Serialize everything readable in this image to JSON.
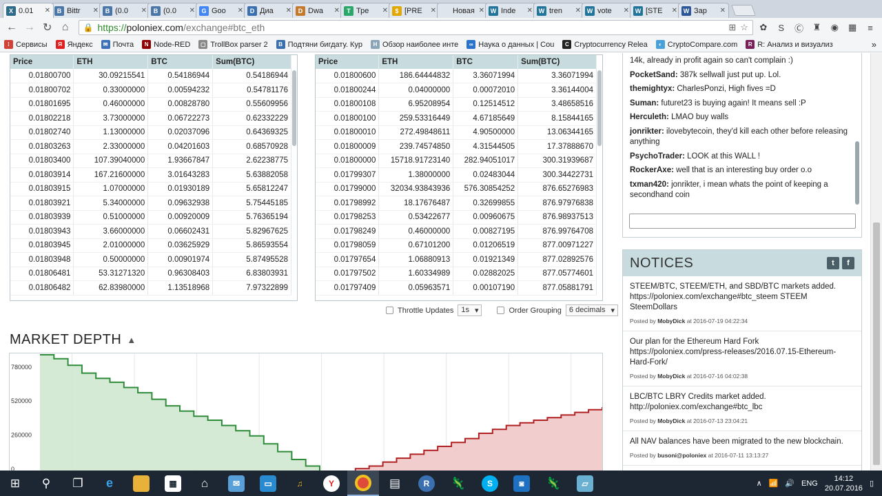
{
  "browser": {
    "tabs": [
      {
        "label": "0.01",
        "icon": "poloniex-favicon",
        "color": "#2e6b8a",
        "glyph": "X",
        "active": true
      },
      {
        "label": "Bittr",
        "icon": "vk-favicon",
        "color": "#4a76a8",
        "glyph": "B"
      },
      {
        "label": "(0.0",
        "icon": "vk-favicon",
        "color": "#4a76a8",
        "glyph": "B"
      },
      {
        "label": "(0.0",
        "icon": "vk-favicon",
        "color": "#4a76a8",
        "glyph": "B"
      },
      {
        "label": "Goo",
        "icon": "google-favicon",
        "color": "#4285f4",
        "glyph": "G"
      },
      {
        "label": "Диа",
        "icon": "doc-favicon",
        "color": "#3a6fb0",
        "glyph": "D"
      },
      {
        "label": "Dwa",
        "icon": "dwarf-favicon",
        "color": "#c47a2a",
        "glyph": "D"
      },
      {
        "label": "Тре",
        "icon": "trello-favicon",
        "color": "#2aa86a",
        "glyph": "T"
      },
      {
        "label": "[PRE",
        "icon": "coin-favicon",
        "color": "#e0a800",
        "glyph": "$"
      },
      {
        "label": "Новая в",
        "icon": "blank-favicon",
        "color": "#dfe5ec",
        "glyph": ""
      },
      {
        "label": "Inde",
        "icon": "wordpress-favicon",
        "color": "#21759b",
        "glyph": "W"
      },
      {
        "label": "tren",
        "icon": "wordpress-favicon",
        "color": "#21759b",
        "glyph": "W"
      },
      {
        "label": "vote",
        "icon": "wordpress-favicon",
        "color": "#21759b",
        "glyph": "W"
      },
      {
        "label": "[STE",
        "icon": "wordpress-favicon",
        "color": "#21759b",
        "glyph": "W"
      },
      {
        "label": "Зар",
        "icon": "word-favicon",
        "color": "#2b579a",
        "glyph": "W"
      }
    ],
    "url_proto": "https://",
    "url_host": "poloniex.com",
    "url_rest": "/exchange#btc_eth",
    "bookmarks": [
      {
        "label": "Сервисы",
        "icon": "apps-icon",
        "color": "#d04437",
        "glyph": "⁞"
      },
      {
        "label": "Яндекс",
        "icon": "yandex-icon",
        "color": "#e02020",
        "glyph": "Я"
      },
      {
        "label": "Почта",
        "icon": "mail-icon",
        "color": "#3b6fb6",
        "glyph": "✉"
      },
      {
        "label": "Node-RED",
        "icon": "nodered-icon",
        "color": "#8f0000",
        "glyph": "N"
      },
      {
        "label": "TrollBox parser 2",
        "icon": "doc-icon",
        "color": "#888888",
        "glyph": "▢"
      },
      {
        "label": "Подтяни бигдату. Кур",
        "icon": "bigdata-icon",
        "color": "#3a6fb0",
        "glyph": "B"
      },
      {
        "label": "Обзор наиболее инте",
        "icon": "habr-icon",
        "color": "#8aa4b8",
        "glyph": "H"
      },
      {
        "label": "Наука о данных | Cou",
        "icon": "coursera-icon",
        "color": "#2a73cc",
        "glyph": "∞"
      },
      {
        "label": "Cryptocurrency Relea",
        "icon": "cc-icon",
        "color": "#222222",
        "glyph": "C"
      },
      {
        "label": "CryptoCompare.com",
        "icon": "cryptocompare-icon",
        "color": "#4aa0d8",
        "glyph": "◐"
      },
      {
        "label": "R: Анализ и визуализ",
        "icon": "r-icon",
        "color": "#7a1f5a",
        "glyph": "R"
      }
    ]
  },
  "orderbook": {
    "columns": [
      "Price",
      "ETH",
      "BTC",
      "Sum(BTC)"
    ],
    "sell_rows": [
      [
        "0.01800700",
        "30.09215541",
        "0.54186944",
        "0.54186944"
      ],
      [
        "0.01800702",
        "0.33000000",
        "0.00594232",
        "0.54781176"
      ],
      [
        "0.01801695",
        "0.46000000",
        "0.00828780",
        "0.55609956"
      ],
      [
        "0.01802218",
        "3.73000000",
        "0.06722273",
        "0.62332229"
      ],
      [
        "0.01802740",
        "1.13000000",
        "0.02037096",
        "0.64369325"
      ],
      [
        "0.01803263",
        "2.33000000",
        "0.04201603",
        "0.68570928"
      ],
      [
        "0.01803400",
        "107.39040000",
        "1.93667847",
        "2.62238775"
      ],
      [
        "0.01803914",
        "167.21600000",
        "3.01643283",
        "5.63882058"
      ],
      [
        "0.01803915",
        "1.07000000",
        "0.01930189",
        "5.65812247"
      ],
      [
        "0.01803921",
        "5.34000000",
        "0.09632938",
        "5.75445185"
      ],
      [
        "0.01803939",
        "0.51000000",
        "0.00920009",
        "5.76365194"
      ],
      [
        "0.01803943",
        "3.66000000",
        "0.06602431",
        "5.82967625"
      ],
      [
        "0.01803945",
        "2.01000000",
        "0.03625929",
        "5.86593554"
      ],
      [
        "0.01803948",
        "0.50000000",
        "0.00901974",
        "5.87495528"
      ],
      [
        "0.01806481",
        "53.31271320",
        "0.96308403",
        "6.83803931"
      ],
      [
        "0.01806482",
        "62.83980000",
        "1.13518968",
        "7.97322899"
      ]
    ],
    "buy_rows": [
      [
        "0.01800600",
        "186.64444832",
        "3.36071994",
        "3.36071994"
      ],
      [
        "0.01800244",
        "0.04000000",
        "0.00072010",
        "3.36144004"
      ],
      [
        "0.01800108",
        "6.95208954",
        "0.12514512",
        "3.48658516"
      ],
      [
        "0.01800100",
        "259.53316449",
        "4.67185649",
        "8.15844165"
      ],
      [
        "0.01800010",
        "272.49848611",
        "4.90500000",
        "13.06344165"
      ],
      [
        "0.01800009",
        "239.74574850",
        "4.31544505",
        "17.37888670"
      ],
      [
        "0.01800000",
        "15718.91723140",
        "282.94051017",
        "300.31939687"
      ],
      [
        "0.01799307",
        "1.38000000",
        "0.02483044",
        "300.34422731"
      ],
      [
        "0.01799000",
        "32034.93843936",
        "576.30854252",
        "876.65276983"
      ],
      [
        "0.01798992",
        "18.17676487",
        "0.32699855",
        "876.97976838"
      ],
      [
        "0.01798253",
        "0.53422677",
        "0.00960675",
        "876.98937513"
      ],
      [
        "0.01798249",
        "0.46000000",
        "0.00827195",
        "876.99764708"
      ],
      [
        "0.01798059",
        "0.67101200",
        "0.01206519",
        "877.00971227"
      ],
      [
        "0.01797654",
        "1.06880913",
        "0.01921349",
        "877.02892576"
      ],
      [
        "0.01797502",
        "1.60334989",
        "0.02882025",
        "877.05774601"
      ],
      [
        "0.01797409",
        "0.05963571",
        "0.00107190",
        "877.05881791"
      ]
    ],
    "throttle_label": "Throttle Updates",
    "throttle_value": "1s",
    "grouping_label": "Order Grouping",
    "grouping_value": "6 decimals"
  },
  "market_depth": {
    "title": "MARKET DEPTH",
    "chart_data": {
      "type": "area",
      "title": "MARKET DEPTH",
      "ylabel": "",
      "xlabel": "",
      "y_ticks": [
        "780000",
        "520000",
        "260000",
        "0"
      ],
      "ylim": [
        0,
        900000
      ],
      "series": [
        {
          "side": "bids",
          "color": "#2e8b3a",
          "fill": "#cfe8cf",
          "values": [
            900000,
            870000,
            820000,
            760000,
            720000,
            690000,
            650000,
            610000,
            560000,
            510000,
            470000,
            430000,
            400000,
            360000,
            320000,
            280000,
            220000,
            160000,
            100000,
            50000,
            10000
          ]
        },
        {
          "side": "asks",
          "color": "#b02020",
          "fill": "#f0c8c8",
          "values": [
            0,
            10000,
            30000,
            50000,
            80000,
            110000,
            140000,
            170000,
            200000,
            230000,
            260000,
            300000,
            330000,
            360000,
            380000,
            400000,
            420000,
            440000,
            460000,
            480000,
            500000
          ]
        }
      ]
    }
  },
  "trollbox": {
    "messages": [
      {
        "user": "",
        "text": "14k, already in profit again so can't complain :)"
      },
      {
        "user": "PocketSand:",
        "text": "387k sellwall just put up. Lol."
      },
      {
        "user": "themightyx:",
        "text": "CharlesPonzi, High fives =D"
      },
      {
        "user": "Suman:",
        "text": "futuret23 is buying again! It means sell :P"
      },
      {
        "user": "Herculeth:",
        "text": "LMAO buy walls"
      },
      {
        "user": "jonrikter:",
        "text": "ilovebytecoin, they'd kill each other before releasing anything"
      },
      {
        "user": "PsychoTrader:",
        "text": "LOOK at this WALL !"
      },
      {
        "user": "RockerAxe:",
        "text": "well that is an interesting buy order o.o"
      },
      {
        "user": "txman420:",
        "text": "jonrikter, i mean whats the point of keeping a secondhand coin"
      }
    ]
  },
  "notices": {
    "title": "NOTICES",
    "items": [
      {
        "text": "STEEM/BTC, STEEM/ETH, and SBD/BTC markets added. https://poloniex.com/exchange#btc_steem STEEM SteemDollars",
        "posted_by": "Posted by",
        "author": "MobyDick",
        "at": "at 2016-07-19 04:22:34"
      },
      {
        "text": "Our plan for the Ethereum Hard Fork https://poloniex.com/press-releases/2016.07.15-Ethereum-Hard-Fork/",
        "posted_by": "Posted by",
        "author": "MobyDick",
        "at": "at 2016-07-16 04:02:38"
      },
      {
        "text": "LBC/BTC LBRY Credits market added. http://poloniex.com/exchange#btc_lbc",
        "posted_by": "Posted by",
        "author": "MobyDick",
        "at": "at 2016-07-13 23:04:21"
      },
      {
        "text": "All NAV balances have been migrated to the new blockchain.",
        "posted_by": "Posted by",
        "author": "busoni@poloniex",
        "at": "at 2016-07-11 13:13:27"
      }
    ]
  },
  "taskbar": {
    "lang": "ENG",
    "time": "14:12",
    "date": "20.07.2016"
  }
}
